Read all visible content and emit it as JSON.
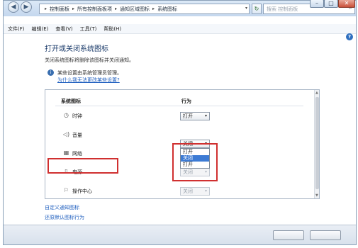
{
  "address": {
    "crumbs": [
      "控制面板",
      "所有控制面板项",
      "通知区域图标",
      "系统图标"
    ]
  },
  "search": {
    "placeholder": "搜索 控制面板"
  },
  "menu": [
    "文件(F)",
    "编辑(E)",
    "查看(V)",
    "工具(T)",
    "帮助(H)"
  ],
  "page": {
    "title": "打开或关闭系统图标",
    "description": "关闭系统图标将删除该图标并关闭通知。",
    "warning_text": "某些设置由系统管理员管理。",
    "warning_link": "为什么我无法更改某些设置?"
  },
  "table": {
    "col_icon": "系统图标",
    "col_behavior": "行为",
    "rows": [
      {
        "icon": "clock-icon",
        "label": "时钟",
        "value": "打开",
        "enabled": true
      },
      {
        "icon": "volume-icon",
        "label": "音量",
        "value": "关闭",
        "enabled": true
      },
      {
        "icon": "network-icon",
        "label": "网络",
        "value": "",
        "enabled": false
      },
      {
        "icon": "power-icon",
        "label": "电源",
        "value": "关闭",
        "enabled": false
      },
      {
        "icon": "action-center-icon",
        "label": "操作中心",
        "value": "关闭",
        "enabled": false
      }
    ],
    "dropdown_options": [
      "打开",
      "关闭",
      "打开"
    ]
  },
  "links": {
    "customize": "自定义通知图标",
    "restore": "还原默认图标行为"
  },
  "colors": {
    "highlight": "#d03030",
    "link": "#1f5fbf",
    "selection": "#3d7bd4"
  }
}
